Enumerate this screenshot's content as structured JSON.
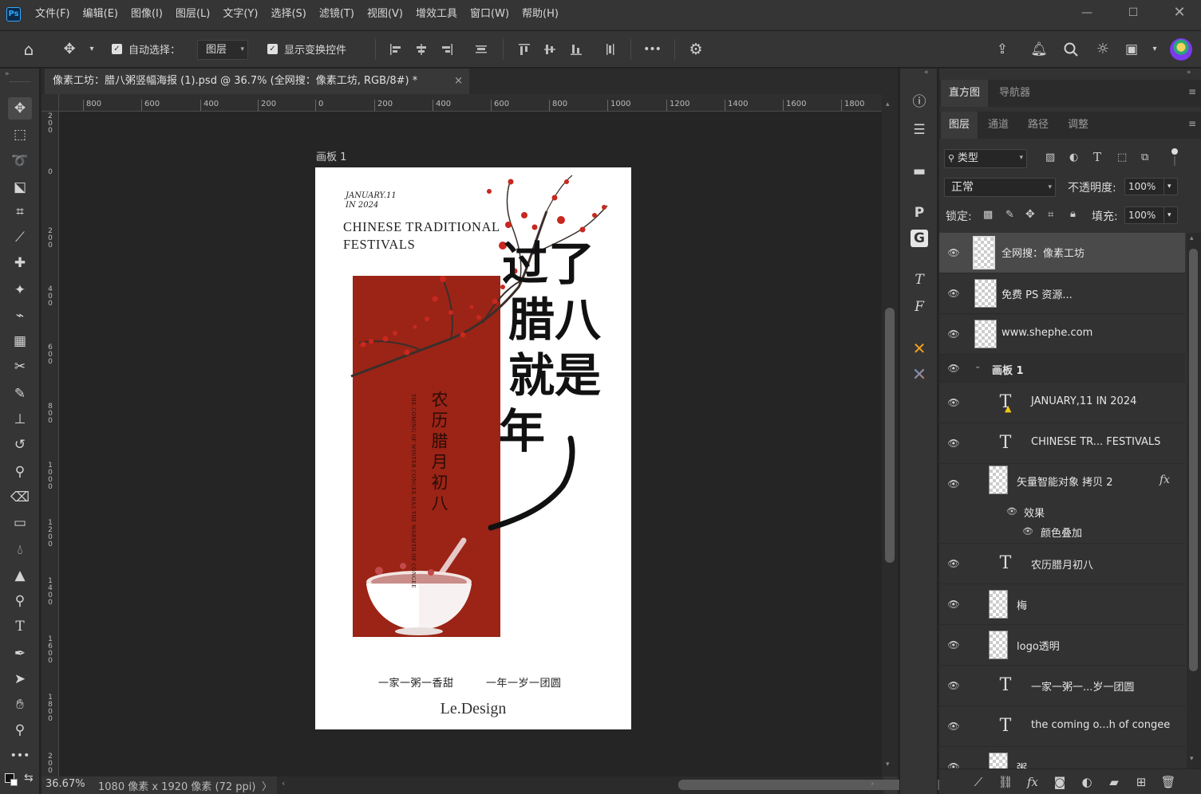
{
  "app": {
    "name": "Photoshop",
    "logo_text": "Ps"
  },
  "menu": [
    "文件(F)",
    "编辑(E)",
    "图像(I)",
    "图层(L)",
    "文字(Y)",
    "选择(S)",
    "滤镜(T)",
    "视图(V)",
    "增效工具",
    "窗口(W)",
    "帮助(H)"
  ],
  "options": {
    "auto_select_label": "自动选择：",
    "auto_select_checked": true,
    "auto_select_target": "图层",
    "show_transform_label": "显示变换控件",
    "show_transform_checked": true,
    "more": "•••"
  },
  "document": {
    "tab_title": "像素工坊：腊八粥竖幅海报 (1).psd @ 36.7% (全网搜：像素工坊, RGB/8#) *",
    "close": "×",
    "artboard_label": "画板 1"
  },
  "ruler": {
    "horizontal": [
      "800",
      "600",
      "400",
      "200",
      "0",
      "200",
      "400",
      "600",
      "800",
      "1000",
      "1200",
      "1400",
      "1600",
      "1800"
    ],
    "vertical": [
      "200",
      "0",
      "200",
      "400",
      "600",
      "800",
      "1000",
      "1200",
      "1400",
      "1600",
      "1800",
      "200"
    ]
  },
  "poster": {
    "date_line1": "JANUARY.11",
    "date_line2": "IN 2024",
    "heading_line1": "CHINESE TRADITIONAL",
    "heading_line2": "FESTIVALS",
    "calligraphy": [
      "过了",
      "腊八",
      "就是",
      "年"
    ],
    "vertical_cn": "农历腊月初八",
    "vertical_en1": "THE COMING OF WINTER",
    "vertical_en2": "CONGEE HAS THE WARMTH OF CONGEE",
    "slogan_left": "一家一粥一香甜",
    "slogan_right": "一年一岁一团圆",
    "brand": "Le.Design",
    "colors": {
      "red_block": "#9b2416",
      "blossom": "#c8281e",
      "ink": "#111111"
    }
  },
  "status": {
    "zoom": "36.67%",
    "info": "1080 像素 x 1920 像素 (72 ppi)",
    "arrow": "〉"
  },
  "right_panel": {
    "top_tabs": [
      "直方图",
      "导航器"
    ],
    "layer_tabs": [
      "图层",
      "通道",
      "路径",
      "调整"
    ],
    "filter_kind": "类型",
    "blend_mode": "正常",
    "opacity_label": "不透明度:",
    "opacity_value": "100%",
    "lock_label": "锁定:",
    "fill_label": "填充:",
    "fill_value": "100%",
    "layers": [
      {
        "name": "全网搜：像素工坊",
        "kind": "pixel",
        "selected": true
      },
      {
        "name": "免费 PS 资源...",
        "kind": "pixel"
      },
      {
        "name": "www.shephe.com",
        "kind": "pixel"
      },
      {
        "name": "画板 1",
        "kind": "artboard"
      },
      {
        "name": "JANUARY,11 IN 2024",
        "kind": "text-warning"
      },
      {
        "name": "CHINESE TR... FESTIVALS",
        "kind": "text"
      },
      {
        "name": "矢量智能对象 拷贝 2",
        "kind": "smart",
        "fx": "fx"
      },
      {
        "name": "效果",
        "kind": "effects"
      },
      {
        "name": "颜色叠加",
        "kind": "effect-item"
      },
      {
        "name": "农历腊月初八",
        "kind": "text"
      },
      {
        "name": "梅",
        "kind": "smart"
      },
      {
        "name": "logo透明",
        "kind": "smart"
      },
      {
        "name": "一家一粥一...岁一团圆",
        "kind": "text"
      },
      {
        "name": "the coming o...h of congee",
        "kind": "text"
      },
      {
        "name": "粥",
        "kind": "smart"
      }
    ]
  }
}
